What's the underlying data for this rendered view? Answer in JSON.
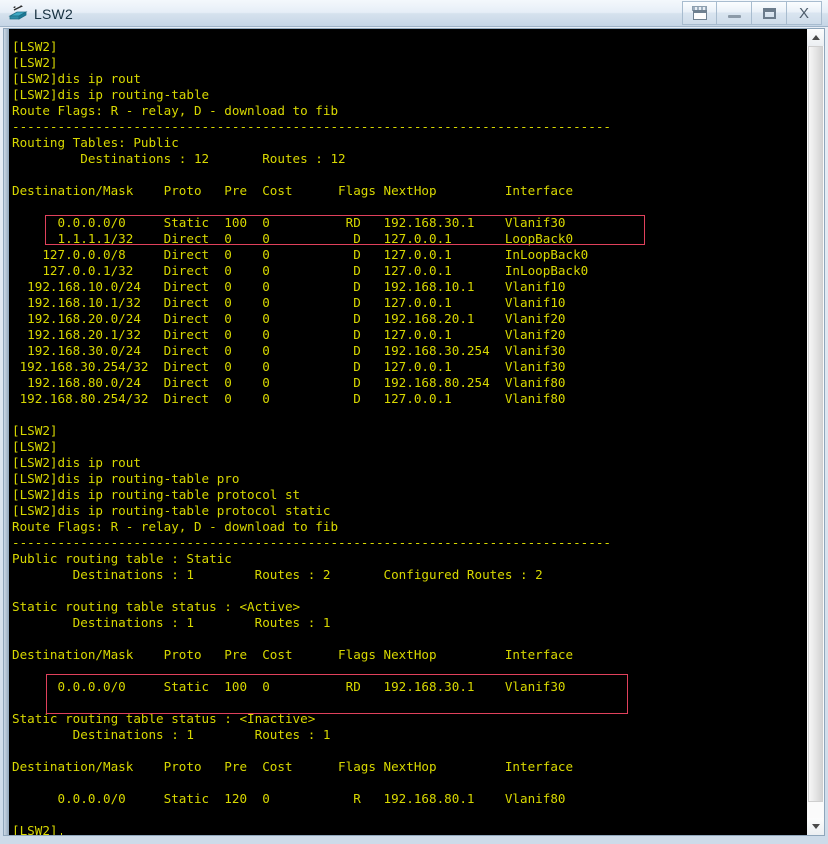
{
  "window": {
    "title": "LSW2",
    "icon": "switch-icon",
    "buttons": [
      {
        "name": "restore-button",
        "icon": "restore-icon",
        "label": ""
      },
      {
        "name": "minimize-button",
        "icon": "minimize-icon",
        "label": ""
      },
      {
        "name": "maximize-button",
        "icon": "maximize-icon",
        "label": ""
      },
      {
        "name": "close-button",
        "icon": "close-icon",
        "label": "X"
      }
    ]
  },
  "colors": {
    "terminal_bg": "#000000",
    "terminal_fg": "#d8d800",
    "highlight": "#e0415c",
    "titlebar": "#dbe5ef"
  },
  "scrollbar": {
    "up_arrow": "chevron-up-icon",
    "down_arrow": "chevron-down-icon"
  },
  "terminal": {
    "prompt": "[LSW2]",
    "caret_line": "[LSW2]",
    "lines": [
      "[LSW2]",
      "[LSW2]",
      "[LSW2]dis ip rout",
      "[LSW2]dis ip routing-table",
      "Route Flags: R - relay, D - download to fib",
      "-------------------------------------------------------------------------------",
      "Routing Tables: Public",
      "         Destinations : 12       Routes : 12",
      "",
      "Destination/Mask    Proto   Pre  Cost      Flags NextHop         Interface",
      "",
      "      0.0.0.0/0     Static  100  0          RD   192.168.30.1    Vlanif30",
      "      1.1.1.1/32    Direct  0    0           D   127.0.0.1       LoopBack0",
      "    127.0.0.0/8     Direct  0    0           D   127.0.0.1       InLoopBack0",
      "    127.0.0.1/32    Direct  0    0           D   127.0.0.1       InLoopBack0",
      "  192.168.10.0/24   Direct  0    0           D   192.168.10.1    Vlanif10",
      "  192.168.10.1/32   Direct  0    0           D   127.0.0.1       Vlanif10",
      "  192.168.20.0/24   Direct  0    0           D   192.168.20.1    Vlanif20",
      "  192.168.20.1/32   Direct  0    0           D   127.0.0.1       Vlanif20",
      "  192.168.30.0/24   Direct  0    0           D   192.168.30.254  Vlanif30",
      " 192.168.30.254/32  Direct  0    0           D   127.0.0.1       Vlanif30",
      "  192.168.80.0/24   Direct  0    0           D   192.168.80.254  Vlanif80",
      " 192.168.80.254/32  Direct  0    0           D   127.0.0.1       Vlanif80",
      "",
      "[LSW2]",
      "[LSW2]",
      "[LSW2]dis ip rout",
      "[LSW2]dis ip routing-table pro",
      "[LSW2]dis ip routing-table protocol st",
      "[LSW2]dis ip routing-table protocol static",
      "Route Flags: R - relay, D - download to fib",
      "-------------------------------------------------------------------------------",
      "Public routing table : Static",
      "        Destinations : 1        Routes : 2       Configured Routes : 2",
      "",
      "Static routing table status : <Active>",
      "        Destinations : 1        Routes : 1",
      "",
      "Destination/Mask    Proto   Pre  Cost      Flags NextHop         Interface",
      "",
      "      0.0.0.0/0     Static  100  0          RD   192.168.30.1    Vlanif30",
      "",
      "Static routing table status : <Inactive>",
      "        Destinations : 1        Routes : 1",
      "",
      "Destination/Mask    Proto   Pre  Cost      Flags NextHop         Interface",
      "",
      "      0.0.0.0/0     Static  120  0           R   192.168.80.1    Vlanif80",
      "",
      "[LSW2]"
    ]
  },
  "routing_tables": {
    "public": {
      "header": "Routing Tables: Public",
      "destinations": "12",
      "routes": "12",
      "columns": [
        "Destination/Mask",
        "Proto",
        "Pre",
        "Cost",
        "Flags",
        "NextHop",
        "Interface"
      ],
      "rows": [
        [
          "0.0.0.0/0",
          "Static",
          "100",
          "0",
          "RD",
          "192.168.30.1",
          "Vlanif30"
        ],
        [
          "1.1.1.1/32",
          "Direct",
          "0",
          "0",
          "D",
          "127.0.0.1",
          "LoopBack0"
        ],
        [
          "127.0.0.0/8",
          "Direct",
          "0",
          "0",
          "D",
          "127.0.0.1",
          "InLoopBack0"
        ],
        [
          "127.0.0.1/32",
          "Direct",
          "0",
          "0",
          "D",
          "127.0.0.1",
          "InLoopBack0"
        ],
        [
          "192.168.10.0/24",
          "Direct",
          "0",
          "0",
          "D",
          "192.168.10.1",
          "Vlanif10"
        ],
        [
          "192.168.10.1/32",
          "Direct",
          "0",
          "0",
          "D",
          "127.0.0.1",
          "Vlanif10"
        ],
        [
          "192.168.20.0/24",
          "Direct",
          "0",
          "0",
          "D",
          "192.168.20.1",
          "Vlanif20"
        ],
        [
          "192.168.20.1/32",
          "Direct",
          "0",
          "0",
          "D",
          "127.0.0.1",
          "Vlanif20"
        ],
        [
          "192.168.30.0/24",
          "Direct",
          "0",
          "0",
          "D",
          "192.168.30.254",
          "Vlanif30"
        ],
        [
          "192.168.30.254/32",
          "Direct",
          "0",
          "0",
          "D",
          "127.0.0.1",
          "Vlanif30"
        ],
        [
          "192.168.80.0/24",
          "Direct",
          "0",
          "0",
          "D",
          "192.168.80.254",
          "Vlanif80"
        ],
        [
          "192.168.80.254/32",
          "Direct",
          "0",
          "0",
          "D",
          "127.0.0.1",
          "Vlanif80"
        ]
      ]
    },
    "static": {
      "header": "Public routing table : Static",
      "destinations": "1",
      "routes": "2",
      "configured_routes": "2",
      "active": {
        "status": "Static routing table status : <Active>",
        "destinations": "1",
        "routes": "1",
        "rows": [
          [
            "0.0.0.0/0",
            "Static",
            "100",
            "0",
            "RD",
            "192.168.30.1",
            "Vlanif30"
          ]
        ]
      },
      "inactive": {
        "status": "Static routing table status : <Inactive>",
        "destinations": "1",
        "routes": "1",
        "rows": [
          [
            "0.0.0.0/0",
            "Static",
            "120",
            "0",
            "R",
            "192.168.80.1",
            "Vlanif80"
          ]
        ]
      }
    }
  },
  "annotations": [
    {
      "name": "highlight-default-route-public",
      "color": "#e0415c"
    },
    {
      "name": "highlight-default-route-static-active",
      "color": "#e0415c"
    }
  ]
}
